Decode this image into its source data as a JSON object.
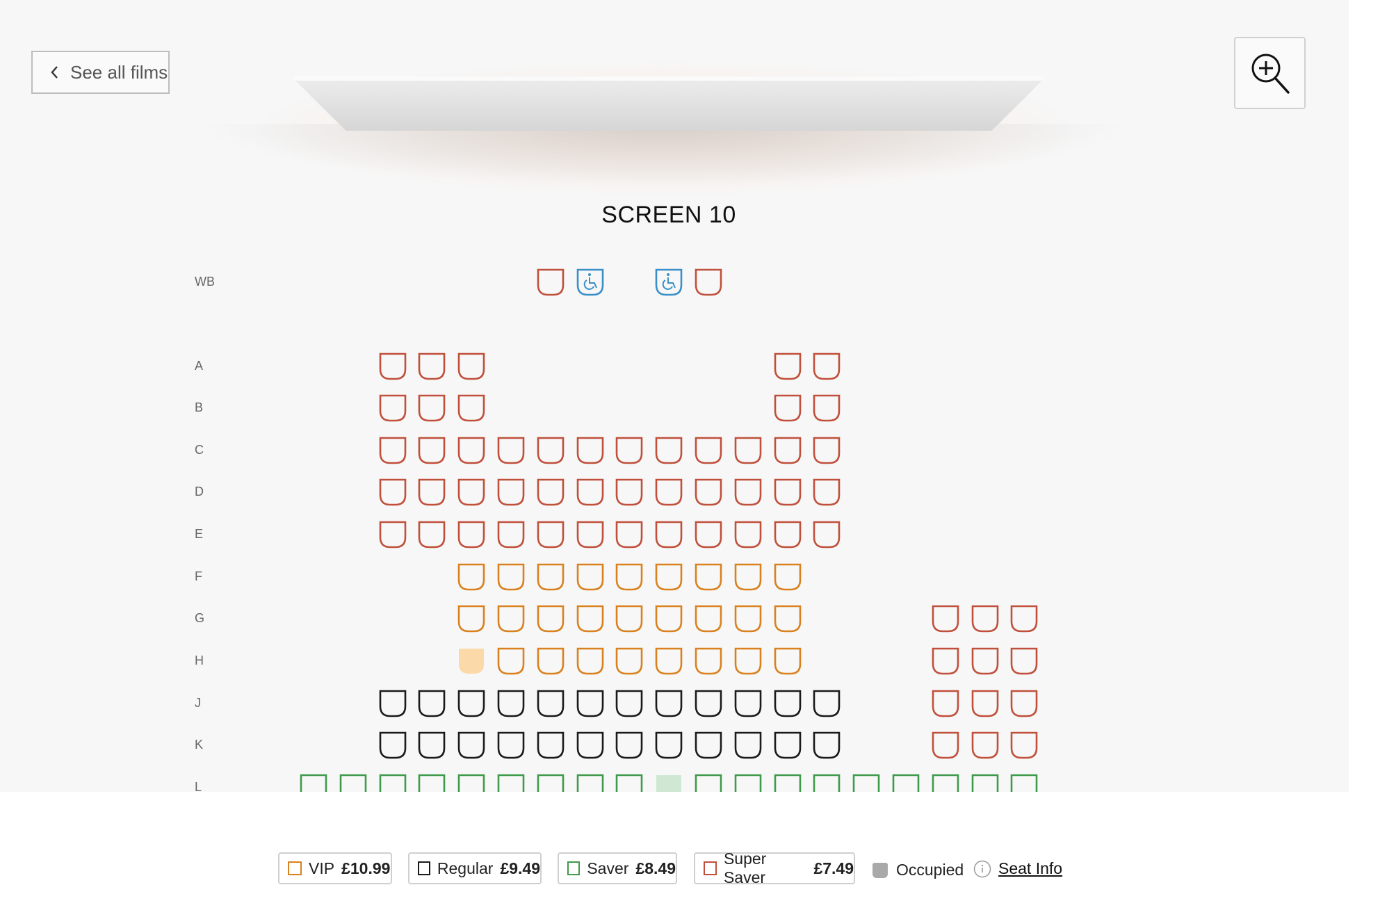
{
  "nav": {
    "back_label": "See all films"
  },
  "screen": {
    "label": "SCREEN 10"
  },
  "colors": {
    "vip": "#d9811f",
    "regular": "#1a1a1a",
    "saver": "#3f9a4b",
    "super_saver": "#c0503b",
    "wheelchair": "#3a8fc9",
    "vip_selected_fill": "#fbd9a8",
    "saver_selected_fill": "#cfe8d4",
    "occupied": "#a9a9a9"
  },
  "icons": {
    "back": "chevron-left-icon",
    "zoom": "zoom-in-icon",
    "wheelchair": "wheelchair-icon",
    "info": "info-icon"
  },
  "rows": [
    {
      "label": "WB",
      "seats": [
        {
          "col": 6,
          "type": "super_saver"
        },
        {
          "col": 7,
          "type": "wheelchair"
        },
        {
          "col": 9,
          "type": "wheelchair"
        },
        {
          "col": 10,
          "type": "super_saver"
        }
      ]
    },
    {
      "label": "A",
      "start": 2,
      "types": [
        "super_saver",
        "super_saver",
        "super_saver",
        null,
        null,
        null,
        null,
        null,
        null,
        null,
        "super_saver",
        "super_saver"
      ]
    },
    {
      "label": "B",
      "start": 2,
      "types": [
        "super_saver",
        "super_saver",
        "super_saver",
        null,
        null,
        null,
        null,
        null,
        null,
        null,
        "super_saver",
        "super_saver"
      ]
    },
    {
      "label": "C",
      "start": 2,
      "types": [
        "super_saver",
        "super_saver",
        "super_saver",
        "super_saver",
        "super_saver",
        "super_saver",
        "super_saver",
        "super_saver",
        "super_saver",
        "super_saver",
        "super_saver",
        "super_saver"
      ]
    },
    {
      "label": "D",
      "start": 2,
      "types": [
        "super_saver",
        "super_saver",
        "super_saver",
        "super_saver",
        "super_saver",
        "super_saver",
        "super_saver",
        "super_saver",
        "super_saver",
        "super_saver",
        "super_saver",
        "super_saver"
      ]
    },
    {
      "label": "E",
      "start": 2,
      "types": [
        "super_saver",
        "super_saver",
        "super_saver",
        "super_saver",
        "super_saver",
        "super_saver",
        "super_saver",
        "super_saver",
        "super_saver",
        "super_saver",
        "super_saver",
        "super_saver"
      ]
    },
    {
      "label": "F",
      "start": 4,
      "types": [
        "vip",
        "vip",
        "vip",
        "vip",
        "vip",
        "vip",
        "vip",
        "vip",
        "vip"
      ]
    },
    {
      "label": "G",
      "start": 4,
      "types": [
        "vip",
        "vip",
        "vip",
        "vip",
        "vip",
        "vip",
        "vip",
        "vip",
        "vip",
        null,
        null,
        null,
        "super_saver",
        "super_saver",
        "super_saver"
      ]
    },
    {
      "label": "H",
      "start": 4,
      "types": [
        "vip_selected",
        "vip",
        "vip",
        "vip",
        "vip",
        "vip",
        "vip",
        "vip",
        "vip",
        null,
        null,
        null,
        "super_saver",
        "super_saver",
        "super_saver"
      ]
    },
    {
      "label": "J",
      "start": 2,
      "types": [
        "regular",
        "regular",
        "regular",
        "regular",
        "regular",
        "regular",
        "regular",
        "regular",
        "regular",
        "regular",
        "regular",
        "regular",
        null,
        null,
        "super_saver",
        "super_saver",
        "super_saver"
      ]
    },
    {
      "label": "K",
      "start": 2,
      "types": [
        "regular",
        "regular",
        "regular",
        "regular",
        "regular",
        "regular",
        "regular",
        "regular",
        "regular",
        "regular",
        "regular",
        "regular",
        null,
        null,
        "super_saver",
        "super_saver",
        "super_saver"
      ]
    },
    {
      "label": "L",
      "start": 0,
      "types": [
        "saver",
        "saver",
        "saver",
        "saver",
        "saver",
        "saver",
        "saver",
        "saver",
        "saver",
        "saver_selected",
        "saver",
        "saver",
        "saver",
        "saver",
        "saver",
        "saver",
        "saver",
        "saver",
        "saver"
      ]
    }
  ],
  "legend": {
    "vip": {
      "name": "VIP",
      "price": "£10.99"
    },
    "regular": {
      "name": "Regular",
      "price": "£9.49"
    },
    "saver": {
      "name": "Saver",
      "price": "£8.49"
    },
    "super_saver": {
      "name": "Super Saver",
      "price": "£7.49"
    },
    "occupied": {
      "name": "Occupied"
    },
    "seat_info": {
      "name": "Seat Info"
    }
  }
}
